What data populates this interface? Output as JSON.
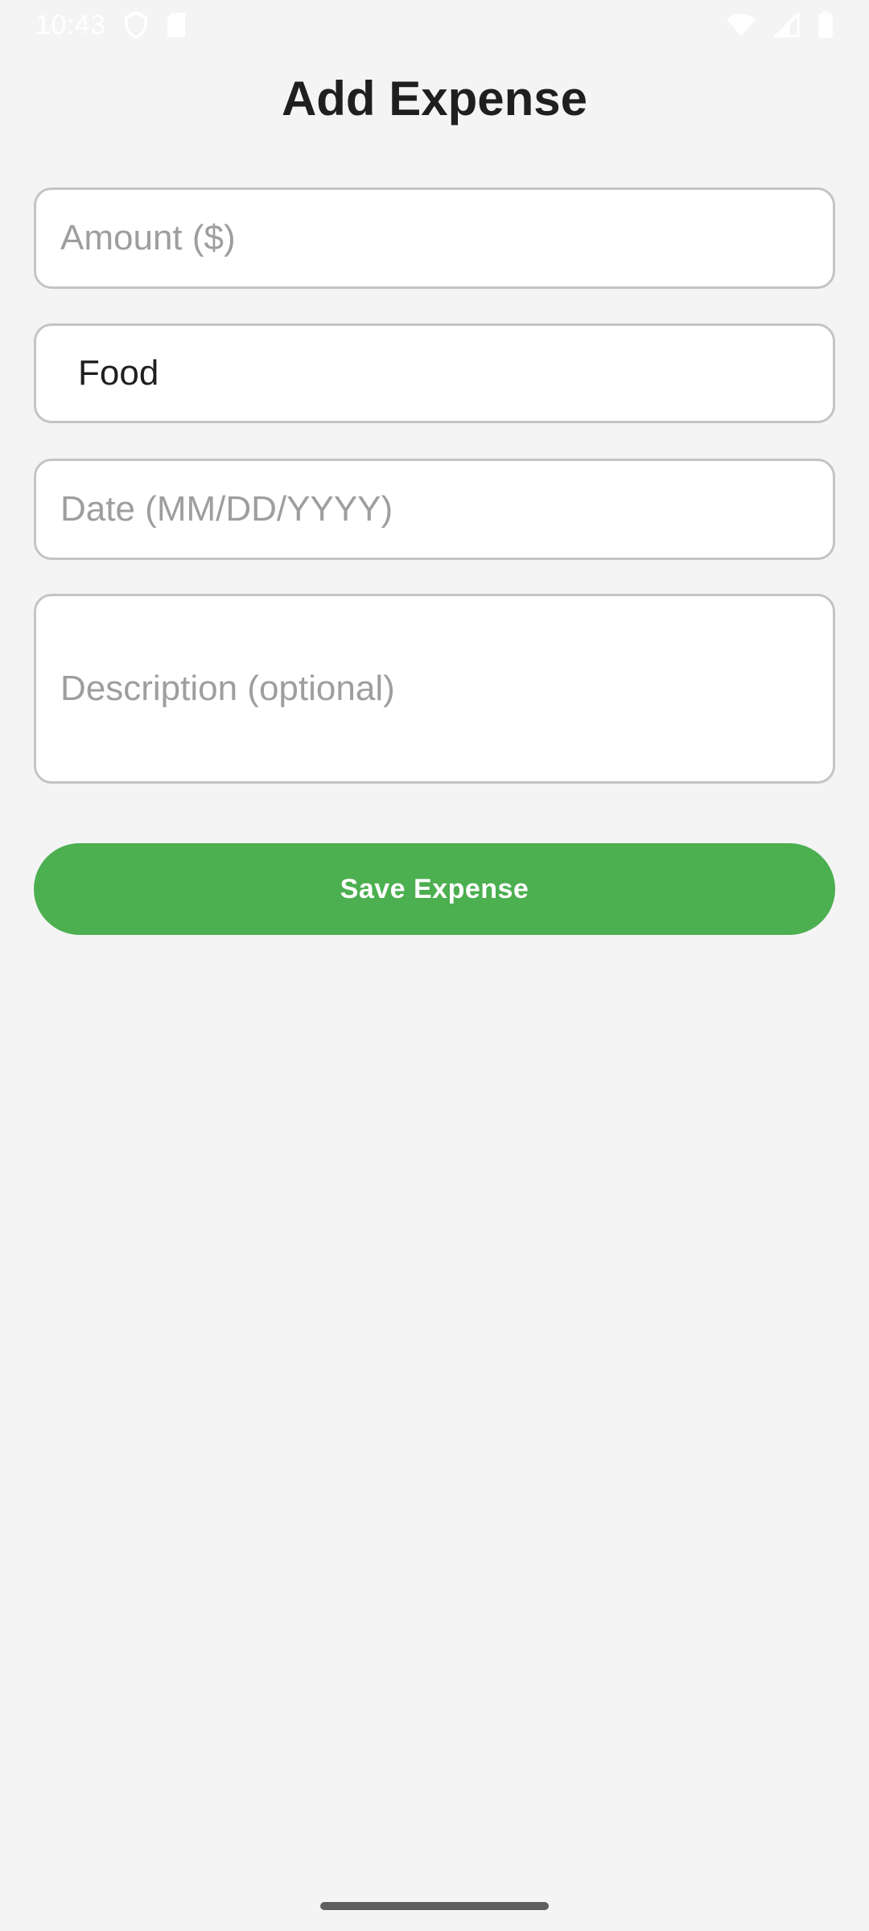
{
  "status_bar": {
    "time": "10:43",
    "icons_left": [
      "shield-icon",
      "sd-card-icon"
    ],
    "icons_right": [
      "wifi-icon",
      "cellular-signal-icon",
      "battery-icon"
    ]
  },
  "header": {
    "title": "Add Expense"
  },
  "form": {
    "amount": {
      "value": "",
      "placeholder": "Amount ($)"
    },
    "category": {
      "value": "Food"
    },
    "date": {
      "value": "",
      "placeholder": "Date (MM/DD/YYYY)"
    },
    "description": {
      "value": "",
      "placeholder": "Description (optional)"
    },
    "save_label": "Save Expense"
  },
  "colors": {
    "background": "#f4f4f4",
    "accent": "#4caf50",
    "field_border": "#c4c4c4",
    "placeholder": "#9e9e9e"
  }
}
